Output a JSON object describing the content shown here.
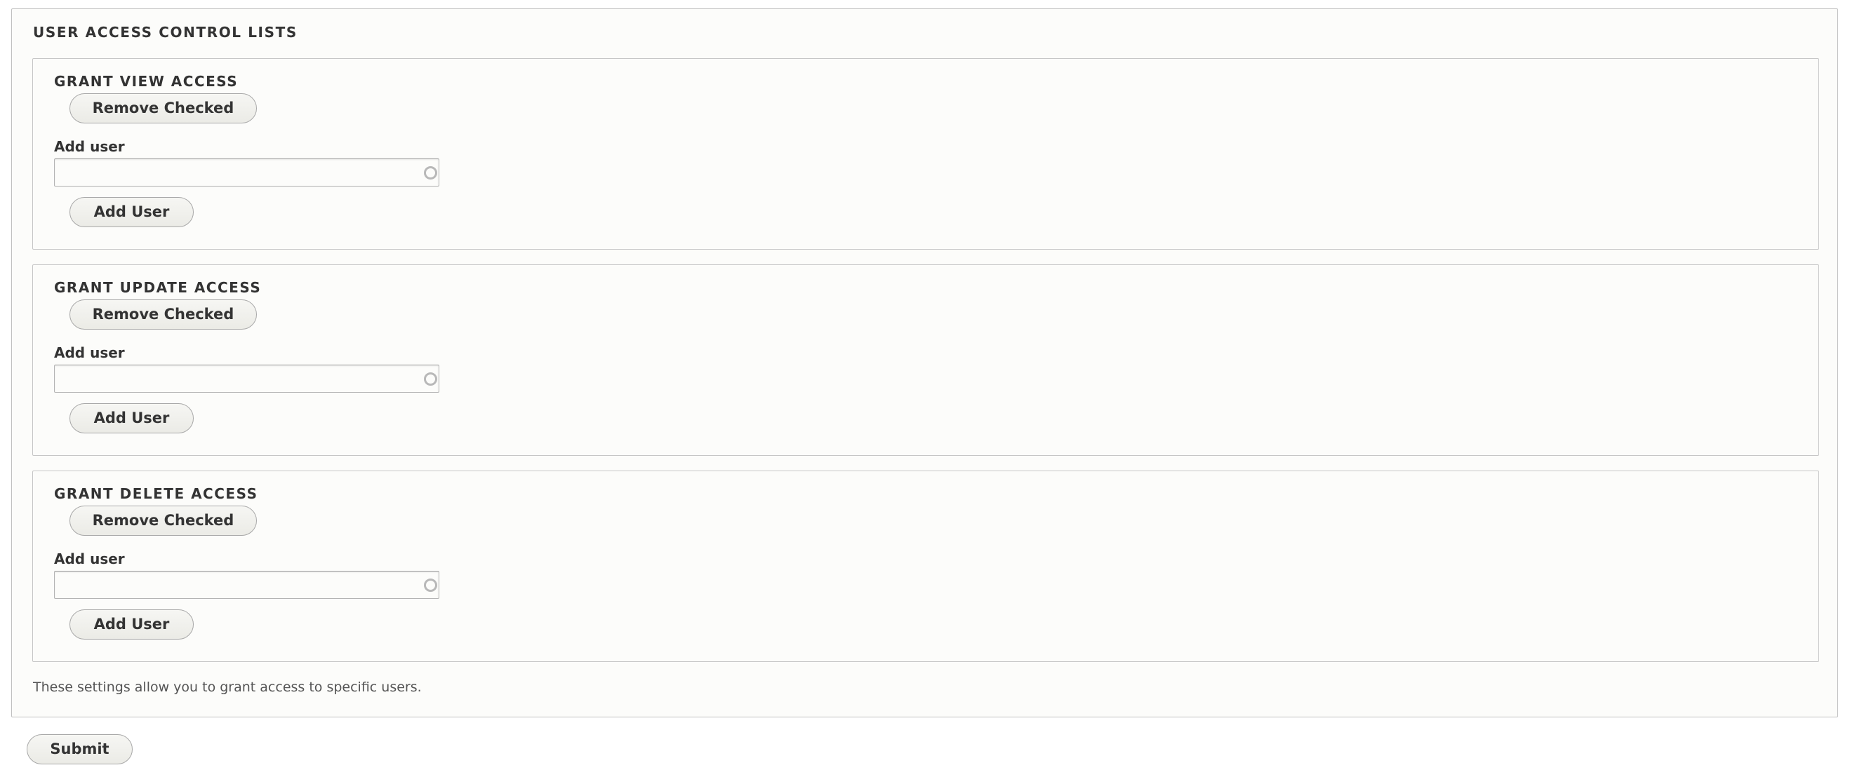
{
  "form": {
    "title": "USER ACCESS CONTROL LISTS",
    "description": "These settings allow you to grant access to specific users.",
    "submit_label": "Submit",
    "sections": [
      {
        "title": "GRANT VIEW ACCESS",
        "remove_label": "Remove Checked",
        "field_label": "Add user",
        "field_value": "",
        "field_placeholder": "",
        "field_icon": "autocomplete-throbber-icon",
        "add_label": "Add User"
      },
      {
        "title": "GRANT UPDATE ACCESS",
        "remove_label": "Remove Checked",
        "field_label": "Add user",
        "field_value": "",
        "field_placeholder": "",
        "field_icon": "autocomplete-throbber-icon",
        "add_label": "Add User"
      },
      {
        "title": "GRANT DELETE ACCESS",
        "remove_label": "Remove Checked",
        "field_label": "Add user",
        "field_value": "",
        "field_placeholder": "",
        "field_icon": "autocomplete-throbber-icon",
        "add_label": "Add User"
      }
    ]
  },
  "colors": {
    "panel_background": "#fcfcfa",
    "border": "#c0c0c0",
    "text": "#333333",
    "description_text": "#555555",
    "button_gradient_top": "#f6f6f3",
    "button_gradient_bottom": "#ebebe6"
  }
}
